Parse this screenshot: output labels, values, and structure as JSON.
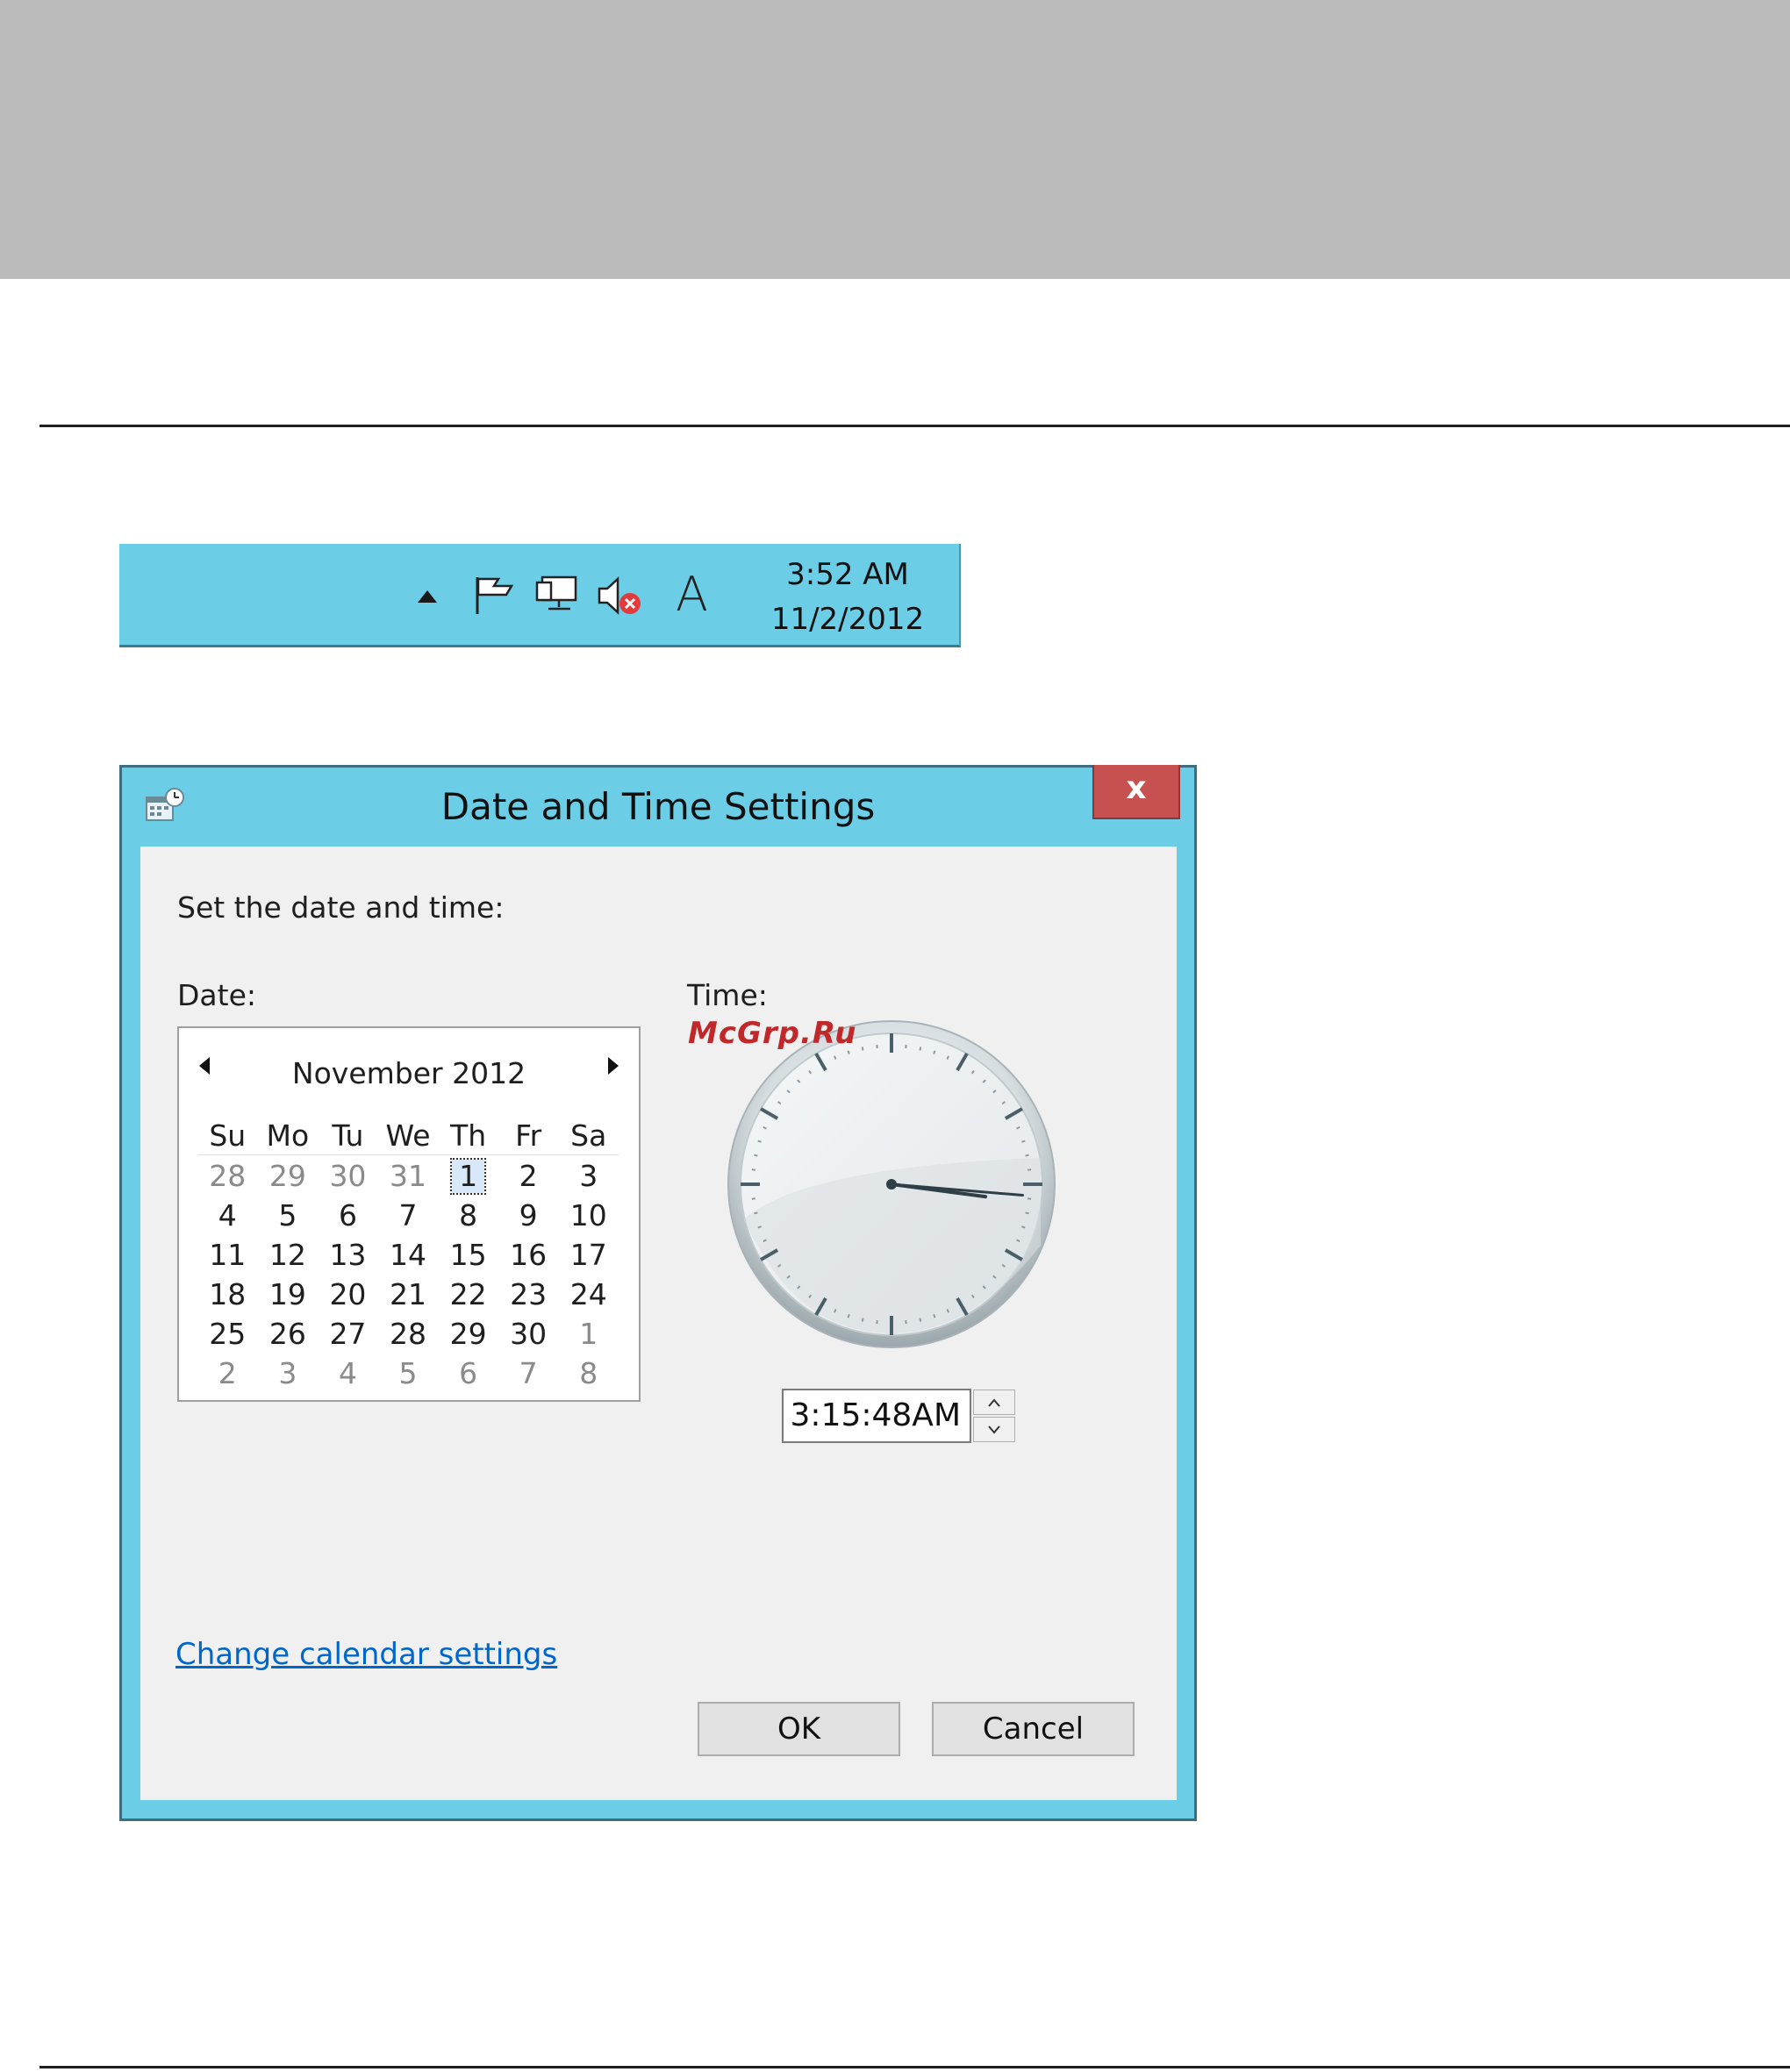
{
  "taskbar": {
    "time": "3:52 AM",
    "date": "11/2/2012",
    "input_indicator": "A",
    "icons": [
      "show-hidden-icons-arrow-icon",
      "action-center-flag-icon",
      "network-icon",
      "speaker-muted-icon",
      "input-method-icon"
    ]
  },
  "dialog": {
    "title": "Date and Time Settings",
    "close_label": "x",
    "instruction": "Set the date and time:",
    "date_label": "Date:",
    "time_label": "Time:",
    "calendar": {
      "month_year": "November 2012",
      "weekdays": [
        "Su",
        "Mo",
        "Tu",
        "We",
        "Th",
        "Fr",
        "Sa"
      ],
      "weeks": [
        [
          "28",
          "29",
          "30",
          "31",
          "1",
          "2",
          "3"
        ],
        [
          "4",
          "5",
          "6",
          "7",
          "8",
          "9",
          "10"
        ],
        [
          "11",
          "12",
          "13",
          "14",
          "15",
          "16",
          "17"
        ],
        [
          "18",
          "19",
          "20",
          "21",
          "22",
          "23",
          "24"
        ],
        [
          "25",
          "26",
          "27",
          "28",
          "29",
          "30",
          "1"
        ],
        [
          "2",
          "3",
          "4",
          "5",
          "6",
          "7",
          "8"
        ]
      ],
      "selected_day": "1"
    },
    "clock": {
      "hour": 3,
      "minute": 15,
      "second": 48
    },
    "time_value": "3:15:48AM",
    "change_calendar_link": "Change calendar settings",
    "ok_label": "OK",
    "cancel_label": "Cancel"
  },
  "watermark": "McGrp.Ru",
  "colors": {
    "chrome_accent": "#6ccde7",
    "close_button": "#c75050",
    "link": "#0066cc",
    "top_band": "#bbbbbb",
    "watermark": "#c1282a"
  }
}
